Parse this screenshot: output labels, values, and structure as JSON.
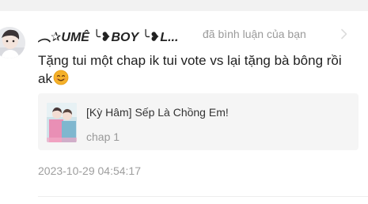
{
  "notification": {
    "user_name": "︵✰UMÊ ╰❥BOY ╰❥L...",
    "action_text": "đã bình luận của bạn",
    "comment_text": "Tặng tui một chap ik tui vote vs lại tặng bà bông rồi ak",
    "comment_emoji": "smiling-face-emoji",
    "linked_item": {
      "title": "[Kỳ Hâm] Sếp Là Chồng Em!",
      "chapter": "chap 1"
    },
    "timestamp": "2023-10-29 04:54:17"
  },
  "icons": {
    "avatar": "user-avatar-photo",
    "chevron": "chevron-right-icon"
  },
  "colors": {
    "background": "#ffffff",
    "top_band": "#f2f2f2",
    "linked_card_bg": "#f5f5f5",
    "primary_text": "#1f1f1f",
    "secondary_text": "#9a9a9a",
    "emoji": "#f5b12a"
  }
}
